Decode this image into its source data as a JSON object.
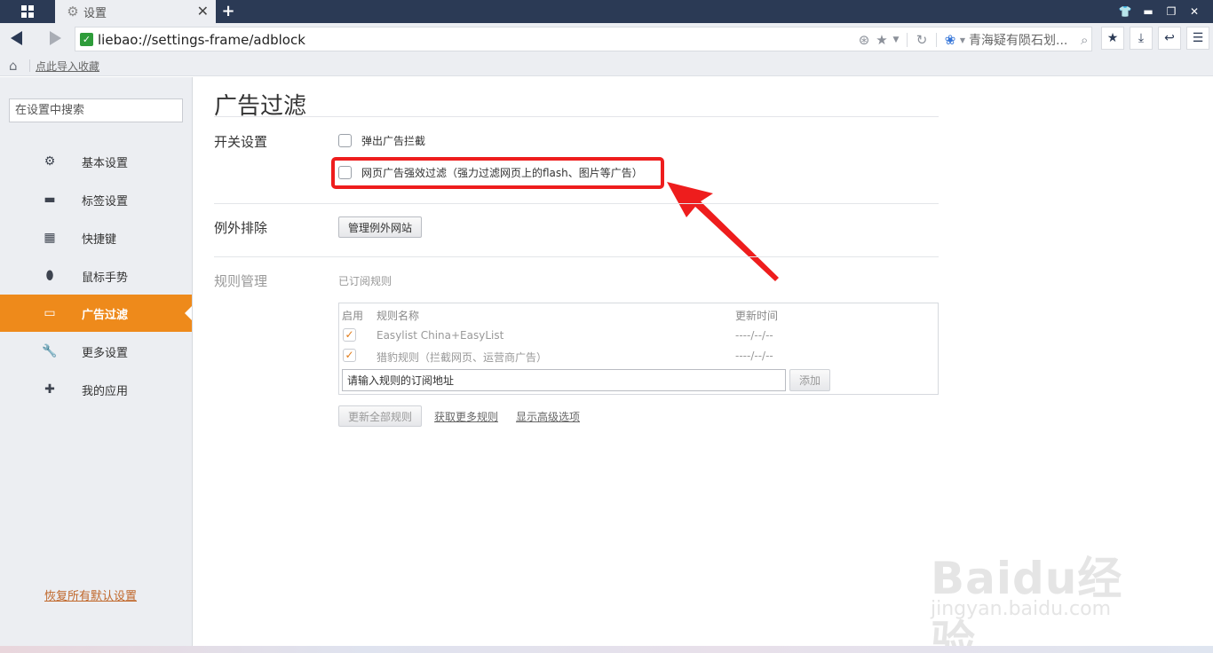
{
  "titlebar": {
    "tab_title": "设置",
    "new_tab": "+",
    "win_controls": [
      "👕",
      "▬",
      "❐",
      "✕"
    ]
  },
  "navbar": {
    "url": "liebao://settings-frame/adblock",
    "search_text": "青海疑有陨石划...",
    "addr_icons": [
      "speed-dial-icon",
      "star-icon",
      "chevron-down-icon",
      "refresh-icon",
      "paw-icon",
      "search-icon"
    ],
    "toolbar": [
      "favorites-icon",
      "download-icon",
      "undo-icon",
      "menu-icon"
    ]
  },
  "bookmarks": {
    "import_link": "点此导入收藏"
  },
  "sidebar": {
    "search_placeholder": "在设置中搜索",
    "items": [
      {
        "label": "基本设置",
        "icon": "gear-icon"
      },
      {
        "label": "标签设置",
        "icon": "tab-icon"
      },
      {
        "label": "快捷键",
        "icon": "keyboard-icon"
      },
      {
        "label": "鼠标手势",
        "icon": "mouse-icon"
      },
      {
        "label": "广告过滤",
        "icon": "adblock-icon",
        "active": true
      },
      {
        "label": "更多设置",
        "icon": "wrench-icon"
      },
      {
        "label": "我的应用",
        "icon": "puzzle-icon"
      }
    ],
    "reset_link": "恢复所有默认设置"
  },
  "content": {
    "title": "广告过滤",
    "switch_section": {
      "label": "开关设置",
      "popup_block": "弹出广告拦截",
      "strong_filter": "网页广告强效过滤（强力过滤网页上的flash、图片等广告）"
    },
    "exception_section": {
      "label": "例外排除",
      "manage_button": "管理例外网站"
    },
    "rules_section": {
      "label": "规则管理",
      "subscribed_label": "已订阅规则",
      "headers": {
        "enabled": "启用",
        "name": "规则名称",
        "updated": "更新时间"
      },
      "rows": [
        {
          "name": "Easylist China+EasyList",
          "updated": "----/--/--"
        },
        {
          "name": "猎豹规则（拦截网页、运营商广告）",
          "updated": "----/--/--"
        }
      ],
      "input_placeholder": "请输入规则的订阅地址",
      "add_button": "添加",
      "update_all_button": "更新全部规则",
      "more_rules_link": "获取更多规则",
      "advanced_link": "显示高级选项"
    }
  },
  "watermark": {
    "brand": "Baidu经验",
    "url": "jingyan.baidu.com"
  },
  "colors": {
    "titlebar": "#2b3a55",
    "accent": "#ee8a1b",
    "highlight": "#ee1d1d"
  }
}
